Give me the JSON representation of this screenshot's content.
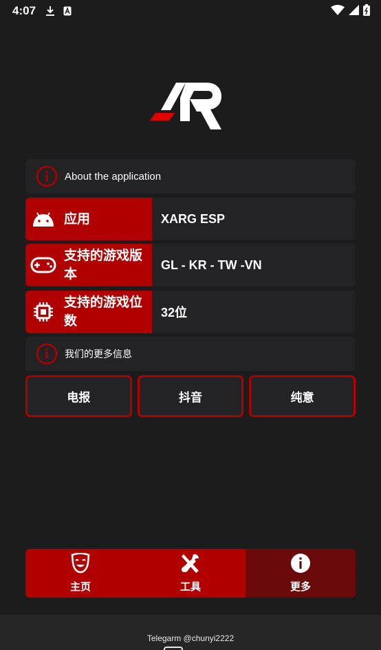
{
  "status_bar": {
    "time": "4:07"
  },
  "about": {
    "title": "About the application"
  },
  "info_rows": [
    {
      "label": "应用",
      "value": "XARG ESP"
    },
    {
      "label": "支持的游戏版本",
      "value": "GL - KR - TW -VN"
    },
    {
      "label": "支持的游戏位数",
      "value": "32位"
    }
  ],
  "more_info": {
    "title": "我们的更多信息"
  },
  "buttons": [
    "电报",
    "抖音",
    "纯意"
  ],
  "bottom_nav": [
    {
      "label": "主页",
      "icon": "theater-mask-icon"
    },
    {
      "label": "工具",
      "icon": "tools-icon"
    },
    {
      "label": "更多",
      "icon": "info-icon",
      "active": true
    }
  ],
  "footer": {
    "credit": "Telegarm @chunyi2222"
  },
  "colors": {
    "accent": "#b00000",
    "active_nav": "#6b0a0a",
    "background": "#1c1c1d",
    "card": "#232325"
  }
}
